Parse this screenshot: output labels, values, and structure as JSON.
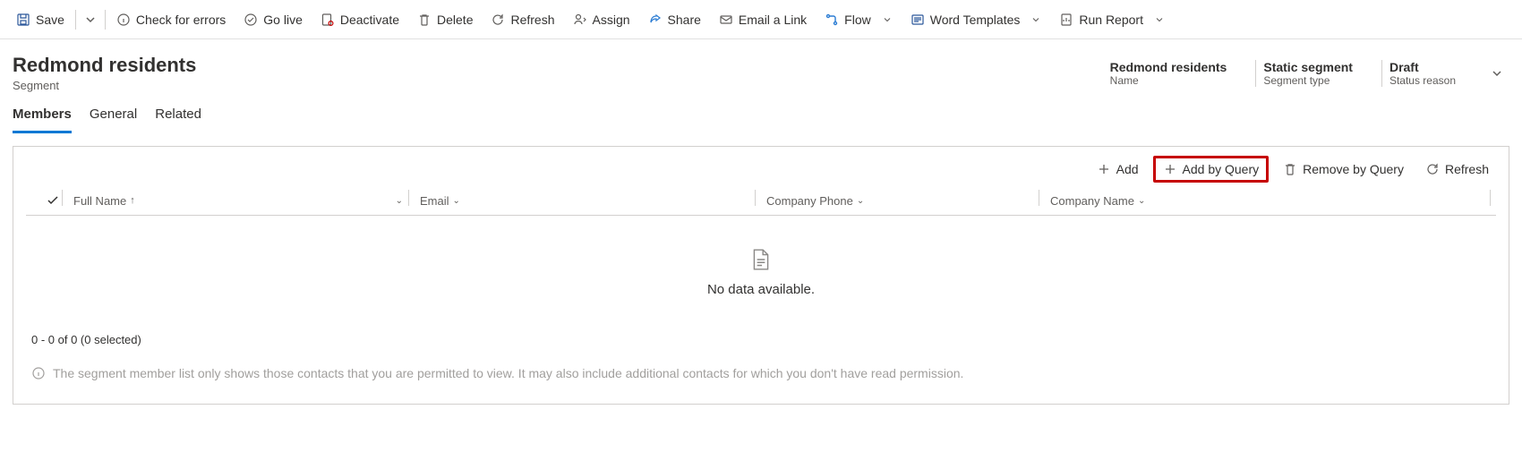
{
  "commandBar": {
    "save": "Save",
    "checkErrors": "Check for errors",
    "goLive": "Go live",
    "deactivate": "Deactivate",
    "delete": "Delete",
    "refresh": "Refresh",
    "assign": "Assign",
    "share": "Share",
    "emailLink": "Email a Link",
    "flow": "Flow",
    "wordTemplates": "Word Templates",
    "runReport": "Run Report"
  },
  "header": {
    "title": "Redmond residents",
    "entity": "Segment",
    "fields": {
      "name": {
        "value": "Redmond residents",
        "label": "Name"
      },
      "segmentType": {
        "value": "Static segment",
        "label": "Segment type"
      },
      "statusReason": {
        "value": "Draft",
        "label": "Status reason"
      }
    }
  },
  "tabs": {
    "members": "Members",
    "general": "General",
    "related": "Related"
  },
  "subgrid": {
    "toolbar": {
      "add": "Add",
      "addByQuery": "Add by Query",
      "removeByQuery": "Remove by Query",
      "refresh": "Refresh"
    },
    "columns": {
      "fullName": "Full Name",
      "email": "Email",
      "companyPhone": "Company Phone",
      "companyName": "Company Name"
    },
    "empty": "No data available.",
    "footer": "0 - 0 of 0 (0 selected)",
    "note": "The segment member list only shows those contacts that you are permitted to view. It may also include additional contacts for which you don't have read permission."
  }
}
